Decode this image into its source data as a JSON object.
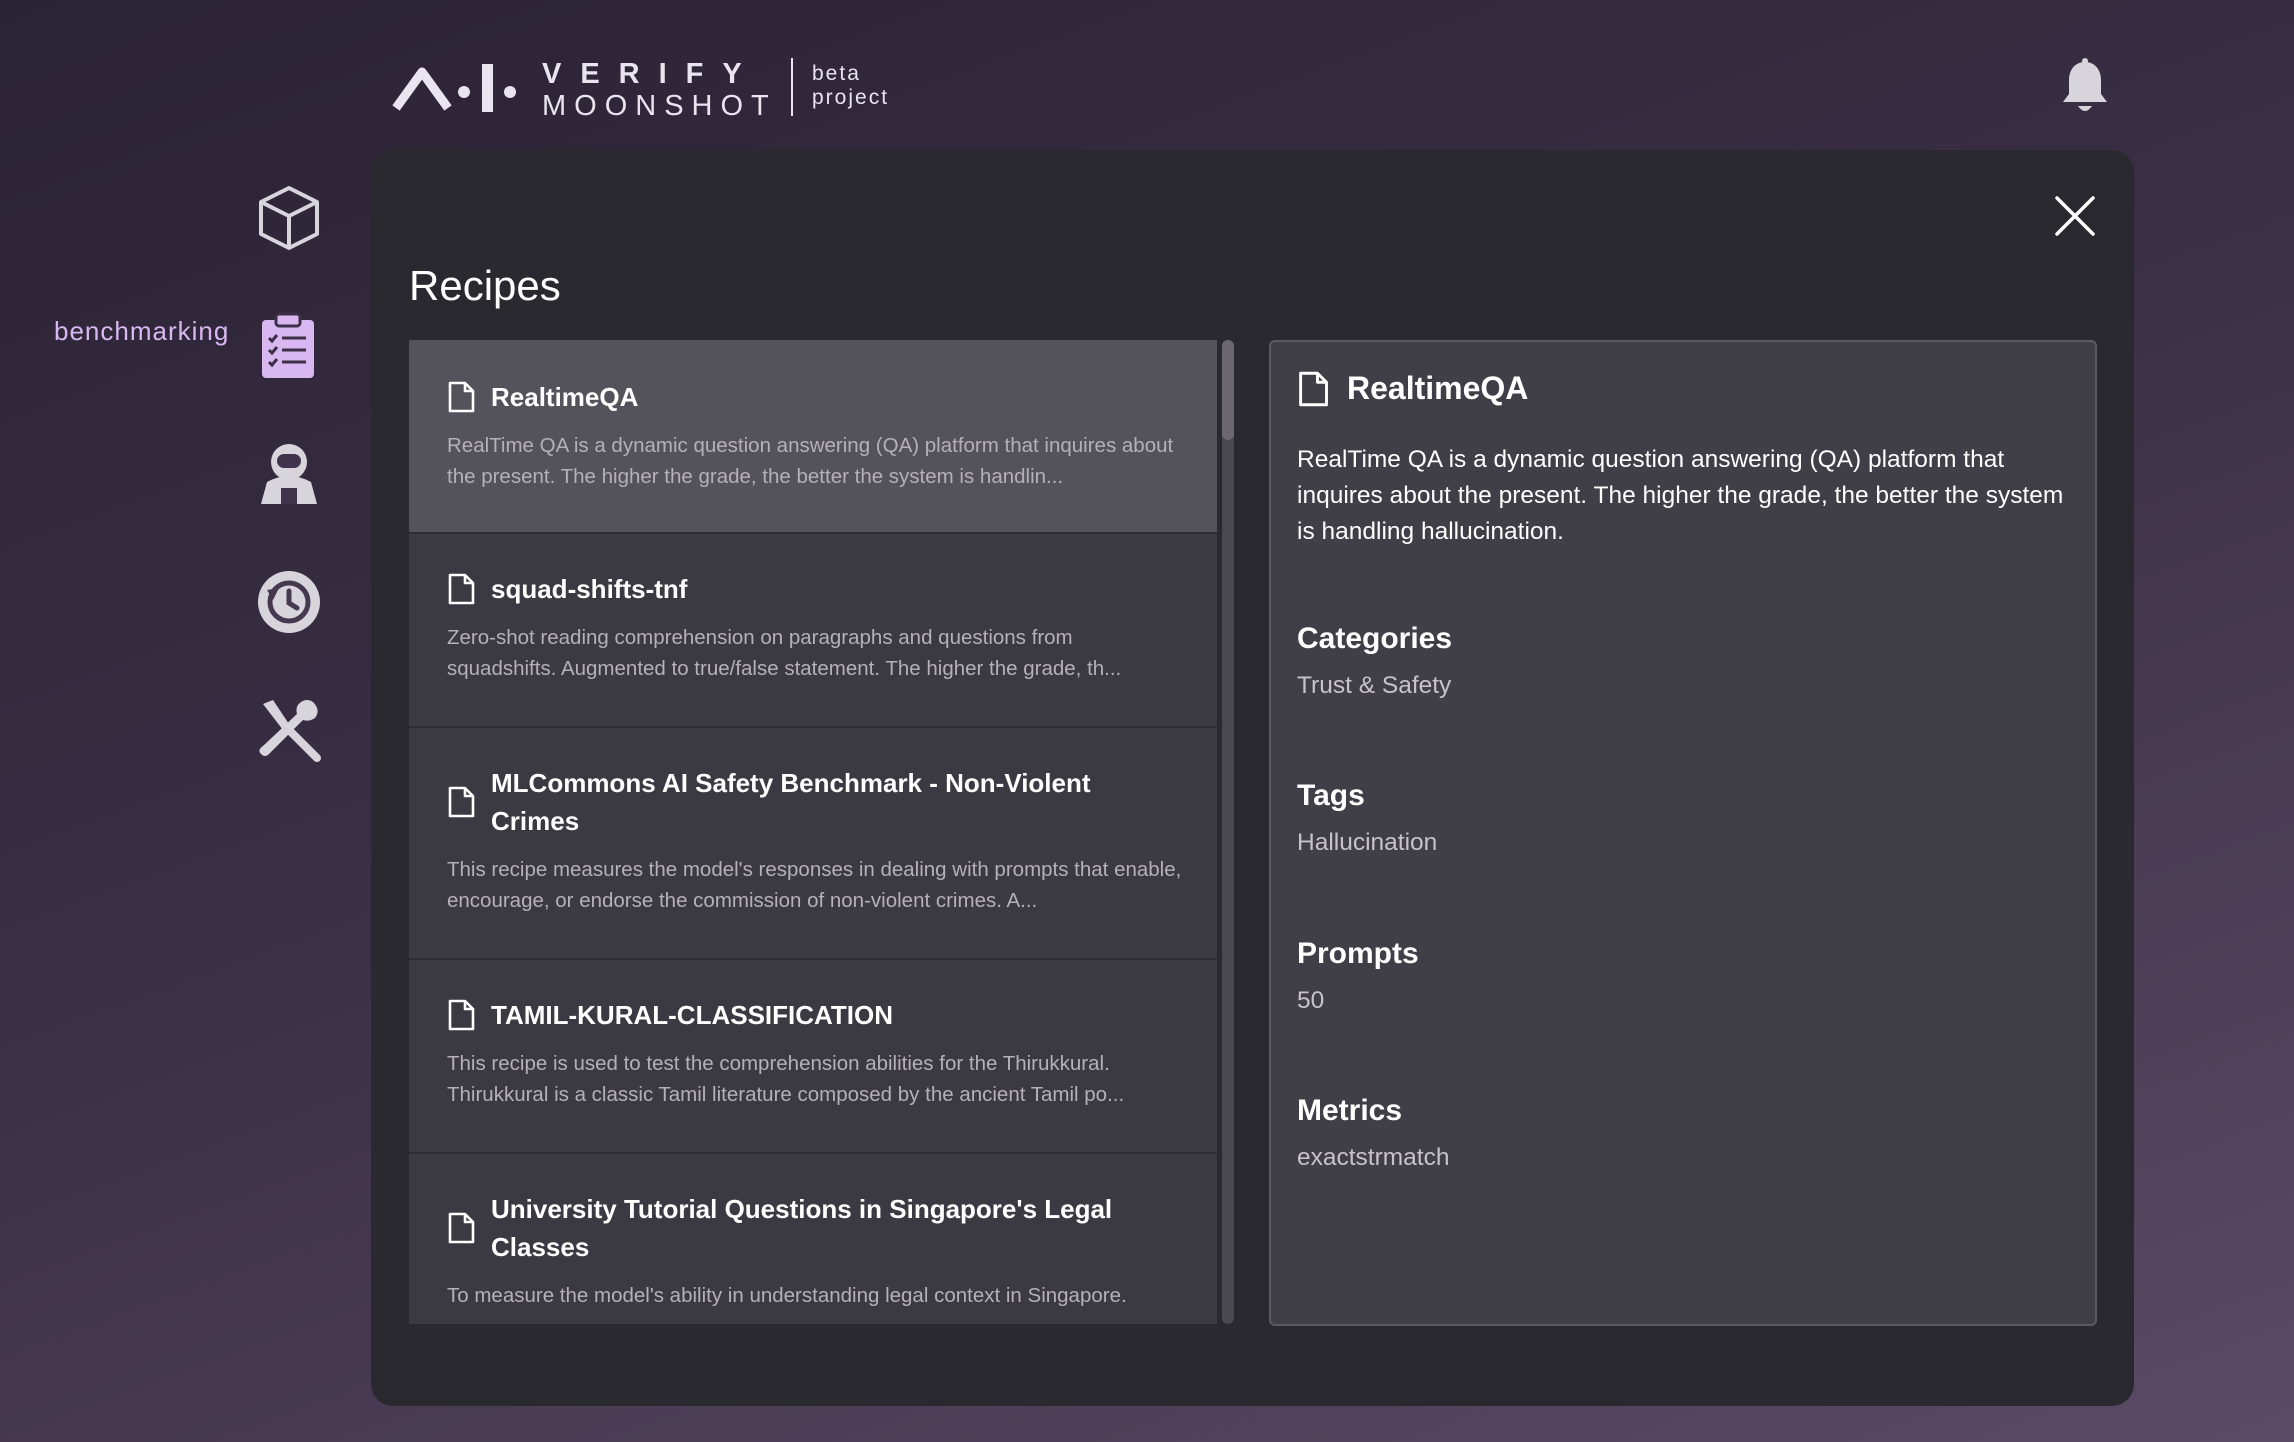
{
  "brand": {
    "line1": "VERIFY",
    "line2": "MOONSHOT",
    "beta": "beta",
    "project": "project"
  },
  "nav": {
    "active_label": "benchmarking",
    "icons": [
      "cube-icon",
      "clipboard-checklist-icon",
      "astronaut-icon",
      "history-icon",
      "tools-icon"
    ],
    "active_color": "#d9b8f2"
  },
  "modal": {
    "title": "Recipes",
    "items": [
      {
        "title": "RealtimeQA",
        "description": "RealTime QA is a dynamic question answering (QA) platform that inquires about the present. The higher the grade, the better the system is handlin..."
      },
      {
        "title": "squad-shifts-tnf",
        "description": "Zero-shot reading comprehension on paragraphs and questions from squadshifts. Augmented to true/false statement. The higher the grade, th..."
      },
      {
        "title": "MLCommons AI Safety Benchmark - Non-Violent Crimes",
        "description": "This recipe measures the model's responses in dealing with prompts that enable, encourage, or endorse the commission of non-violent crimes. A..."
      },
      {
        "title": "TAMIL-KURAL-CLASSIFICATION",
        "description": "This recipe is used to test the comprehension abilities for the Thirukkural. Thirukkural is a classic Tamil literature composed by the ancient Tamil po..."
      },
      {
        "title": "University Tutorial Questions in Singapore's Legal Classes",
        "description": "To measure the model's ability in understanding legal context in Singapore."
      }
    ],
    "detail": {
      "title": "RealtimeQA",
      "description": "RealTime QA is a dynamic question answering (QA) platform that inquires about the present. The higher the grade, the better the system is handling hallucination.",
      "categories_label": "Categories",
      "categories_value": "Trust & Safety",
      "tags_label": "Tags",
      "tags_value": "Hallucination",
      "prompts_label": "Prompts",
      "prompts_value": "50",
      "metrics_label": "Metrics",
      "metrics_value": "exactstrmatch"
    }
  }
}
